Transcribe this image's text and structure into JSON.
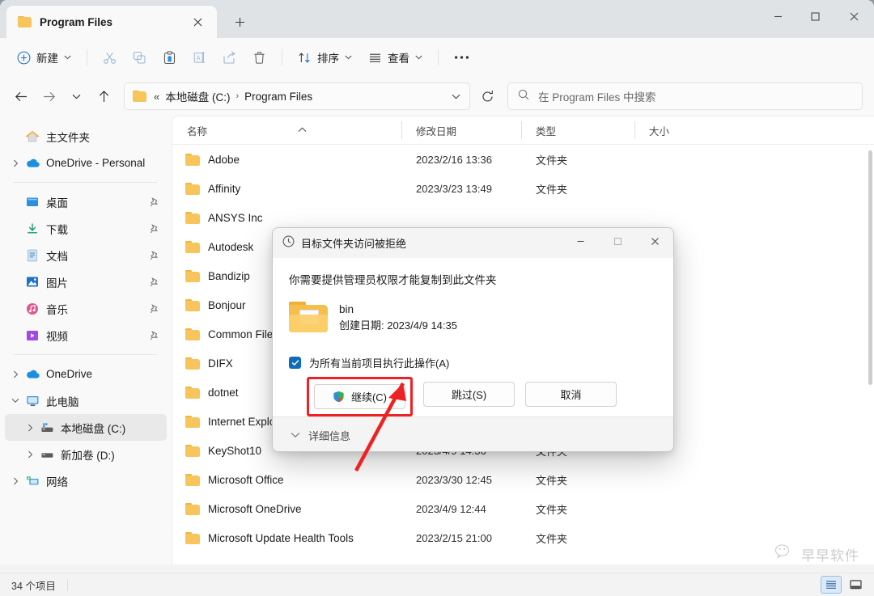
{
  "window": {
    "tab_title": "Program Files",
    "minimize_label": "最小化",
    "maximize_label": "最大化",
    "close_label": "关闭"
  },
  "toolbar": {
    "new_label": "新建",
    "sort_label": "排序",
    "view_label": "查看",
    "cut_label": "剪切",
    "copy_label": "复制",
    "paste_label": "粘贴",
    "rename_label": "重命名",
    "share_label": "共享",
    "delete_label": "删除",
    "more_label": "查看更多"
  },
  "addressbar": {
    "crumb_prefix": "«",
    "crumbs": [
      "本地磁盘 (C:)",
      "Program Files"
    ],
    "separator": "›"
  },
  "search": {
    "placeholder": "在 Program Files 中搜索"
  },
  "sidebar": {
    "groups": [
      {
        "items": [
          {
            "label": "主文件夹",
            "icon": "home-icon",
            "expander": false,
            "pin": false
          },
          {
            "label": "OneDrive - Personal",
            "icon": "onedrive-cloud-icon",
            "expander": true,
            "pin": false
          }
        ]
      },
      {
        "items": [
          {
            "label": "桌面",
            "icon": "desktop-icon",
            "expander": false,
            "pin": true
          },
          {
            "label": "下载",
            "icon": "downloads-icon",
            "expander": false,
            "pin": true
          },
          {
            "label": "文档",
            "icon": "documents-icon",
            "expander": false,
            "pin": true
          },
          {
            "label": "图片",
            "icon": "pictures-icon",
            "expander": false,
            "pin": true
          },
          {
            "label": "音乐",
            "icon": "music-icon",
            "expander": false,
            "pin": true
          },
          {
            "label": "视频",
            "icon": "videos-icon",
            "expander": false,
            "pin": true
          }
        ]
      },
      {
        "items": [
          {
            "label": "OneDrive",
            "icon": "onedrive-cloud-icon",
            "expander": true,
            "pin": false
          },
          {
            "label": "此电脑",
            "icon": "this-pc-icon",
            "expander": true,
            "expanded": true,
            "pin": false
          },
          {
            "label": "本地磁盘 (C:)",
            "icon": "local-disk-icon",
            "expander": true,
            "pin": false,
            "indent": true,
            "selected": true
          },
          {
            "label": "新加卷 (D:)",
            "icon": "drive-icon",
            "expander": true,
            "pin": false,
            "indent": true
          },
          {
            "label": "网络",
            "icon": "network-icon",
            "expander": true,
            "pin": false
          }
        ]
      }
    ]
  },
  "filelist": {
    "columns": [
      "名称",
      "修改日期",
      "类型",
      "大小"
    ],
    "sort_column": "名称",
    "sort_direction": "asc",
    "rows": [
      {
        "name": "Adobe",
        "date": "2023/2/16 13:36",
        "type": "文件夹",
        "size": ""
      },
      {
        "name": "Affinity",
        "date": "2023/3/23 13:49",
        "type": "文件夹",
        "size": ""
      },
      {
        "name": "ANSYS Inc",
        "date": "",
        "type": "",
        "size": ""
      },
      {
        "name": "Autodesk",
        "date": "",
        "type": "",
        "size": ""
      },
      {
        "name": "Bandizip",
        "date": "",
        "type": "",
        "size": ""
      },
      {
        "name": "Bonjour",
        "date": "",
        "type": "",
        "size": ""
      },
      {
        "name": "Common Files",
        "date": "",
        "type": "",
        "size": ""
      },
      {
        "name": "DIFX",
        "date": "",
        "type": "",
        "size": ""
      },
      {
        "name": "dotnet",
        "date": "",
        "type": "",
        "size": ""
      },
      {
        "name": "Internet Explorer",
        "date": "",
        "type": "",
        "size": ""
      },
      {
        "name": "KeyShot10",
        "date": "2023/4/9 14:36",
        "type": "文件夹",
        "size": ""
      },
      {
        "name": "Microsoft Office",
        "date": "2023/3/30 12:45",
        "type": "文件夹",
        "size": ""
      },
      {
        "name": "Microsoft OneDrive",
        "date": "2023/4/9 12:44",
        "type": "文件夹",
        "size": ""
      },
      {
        "name": "Microsoft Update Health Tools",
        "date": "2023/2/15 21:00",
        "type": "文件夹",
        "size": ""
      }
    ]
  },
  "statusbar": {
    "item_count": "34 个项目",
    "view_details_label": "详细信息视图",
    "view_large_label": "大图标视图"
  },
  "dialog": {
    "title": "目标文件夹访问被拒绝",
    "title_icon": "history-clock-icon",
    "message": "你需要提供管理员权限才能复制到此文件夹",
    "file_name": "bin",
    "file_date": "创建日期: 2023/4/9 14:35",
    "checkbox_label": "为所有当前项目执行此操作(A)",
    "checkbox_checked": true,
    "buttons": [
      {
        "label": "继续(C)",
        "icon": "uac-shield-icon",
        "highlighted": true
      },
      {
        "label": "跳过(S)",
        "icon": "",
        "highlighted": false
      },
      {
        "label": "取消",
        "icon": "",
        "highlighted": false
      }
    ],
    "details_label": "详细信息",
    "minimize_label": "最小化",
    "maximize_label": "最大化",
    "close_label": "关闭"
  },
  "annotation": {
    "highlight_color": "#ee2222",
    "arrow_target": "继续(C)"
  },
  "watermark": {
    "text": "早早软件",
    "icon": "wechat-icon"
  }
}
